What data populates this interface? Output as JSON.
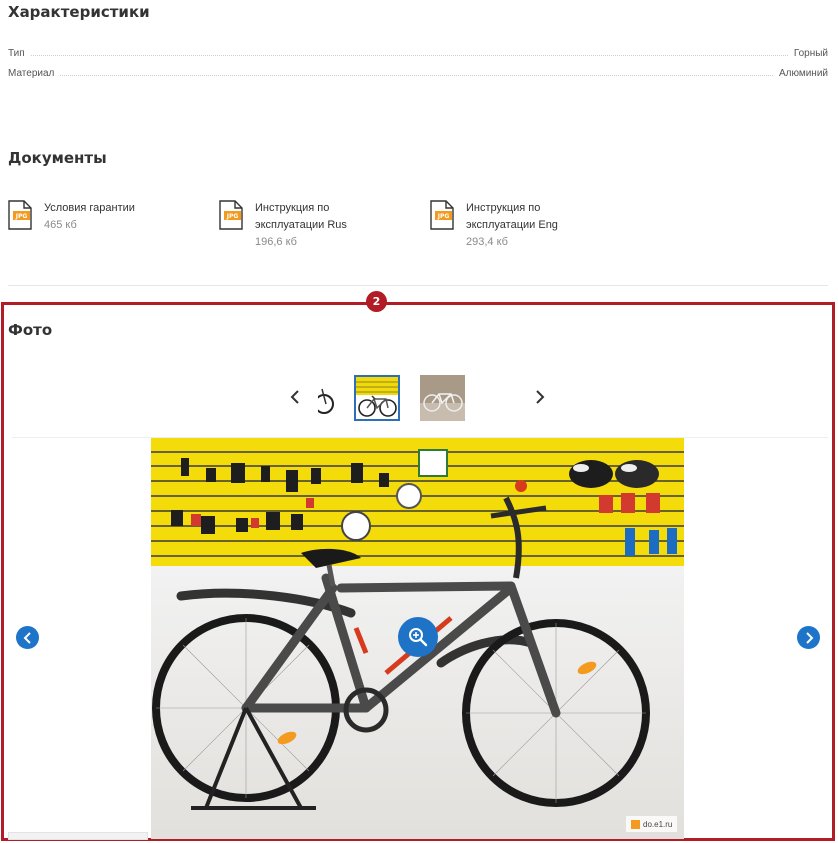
{
  "characteristics": {
    "title": "Характеристики",
    "rows": [
      {
        "label": "Тип",
        "value": "Горный"
      },
      {
        "label": "Материал",
        "value": "Алюминий"
      }
    ]
  },
  "documents": {
    "title": "Документы",
    "items": [
      {
        "icon_text": "JPG",
        "name": "Условия гарантии",
        "size": "465 кб"
      },
      {
        "icon_text": "JPG",
        "name": "Инструкция по эксплуатации Rus",
        "size": "196,6 кб"
      },
      {
        "icon_text": "JPG",
        "name": "Инструкция по эксплуатации Eng",
        "size": "293,4 кб"
      }
    ]
  },
  "annotation": {
    "badge": "2",
    "color": "#b11c26"
  },
  "photo": {
    "title": "Фото",
    "watermark": "do.e1.ru",
    "accent_color": "#1d74c9",
    "icons": {
      "thumb_prev": "chevron-left-icon",
      "thumb_next": "chevron-right-icon",
      "main_prev": "arrow-left-circle-icon",
      "main_next": "arrow-right-circle-icon",
      "zoom": "zoom-in-icon"
    }
  }
}
